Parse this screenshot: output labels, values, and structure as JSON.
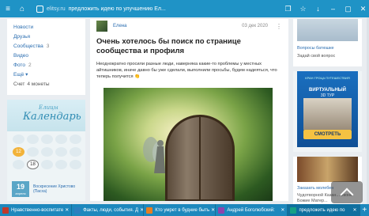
{
  "browser": {
    "url": "elitsy.ru",
    "title": "предложить идею по улучшению Ел...",
    "icons": [
      "menu-icon",
      "home-icon",
      "lock-icon",
      "tabs-icon",
      "bookmarks-icon",
      "download-icon",
      "minimize-icon",
      "restore-icon",
      "close-icon"
    ]
  },
  "sidebar": {
    "items": [
      {
        "label": "Новости",
        "count": ""
      },
      {
        "label": "Друзья",
        "count": ""
      },
      {
        "label": "Сообщества",
        "count": "3"
      },
      {
        "label": "Видео",
        "count": ""
      },
      {
        "label": "Фото",
        "count": "2"
      },
      {
        "label": "Ещё ▾",
        "count": ""
      }
    ],
    "money_label": "Счет",
    "money_value": "4 монеты"
  },
  "calendar": {
    "word_small": "Елицы",
    "word_big": "Календарь",
    "days": [
      "7",
      "8",
      "9",
      "10",
      "11",
      "12",
      "13",
      "14",
      "15",
      "16",
      "17",
      "18",
      "19",
      "20",
      "21"
    ],
    "selected_day": "18",
    "highlighted_day": "12",
    "today_number": "19",
    "today_month": "апреля",
    "event_text": "Воскресение Христово (Пасха)"
  },
  "post": {
    "author": "Елена",
    "date": "03 дек 2020",
    "title": "Очень хотелось бы поиск по странице сообщества и профиля",
    "body": "Неоднократно просили разные люди, наверняка какие-то проблемы у местных айтишников, иначе давно бы уже сделали, выполнили просьбы, будем надеяться, что теперь получится 👏"
  },
  "right": {
    "widget1_title": "Вопросы батюшке",
    "widget1_sub": "Задай свой вопрос",
    "ad_top": "КРАН ГРОЦА ПУТЕШЕСТВИЯ",
    "ad_main": "ВИРТУАЛЬНЫЙ",
    "ad_main2": "3D ТУР",
    "ad_button": "СМОТРЕТЬ",
    "widget3_title": "Заказать молебен",
    "widget3_sub": "Чудотворной Казан... иконе Божие Матер..."
  },
  "taskbar": {
    "tabs": [
      {
        "label": "Нравственно-воспитате",
        "color": "#c0392b",
        "active": false
      },
      {
        "label": "Факты, люди, события. Д",
        "color": "#2c7fbf",
        "active": false
      },
      {
        "label": "Кто умрет в будние быть",
        "color": "#e67e22",
        "active": false
      },
      {
        "label": "Андрей Боголюбский:",
        "color": "#8e44ad",
        "active": false
      },
      {
        "label": "предложить идею по",
        "color": "#16a085",
        "active": true
      }
    ],
    "add_label": "+"
  }
}
